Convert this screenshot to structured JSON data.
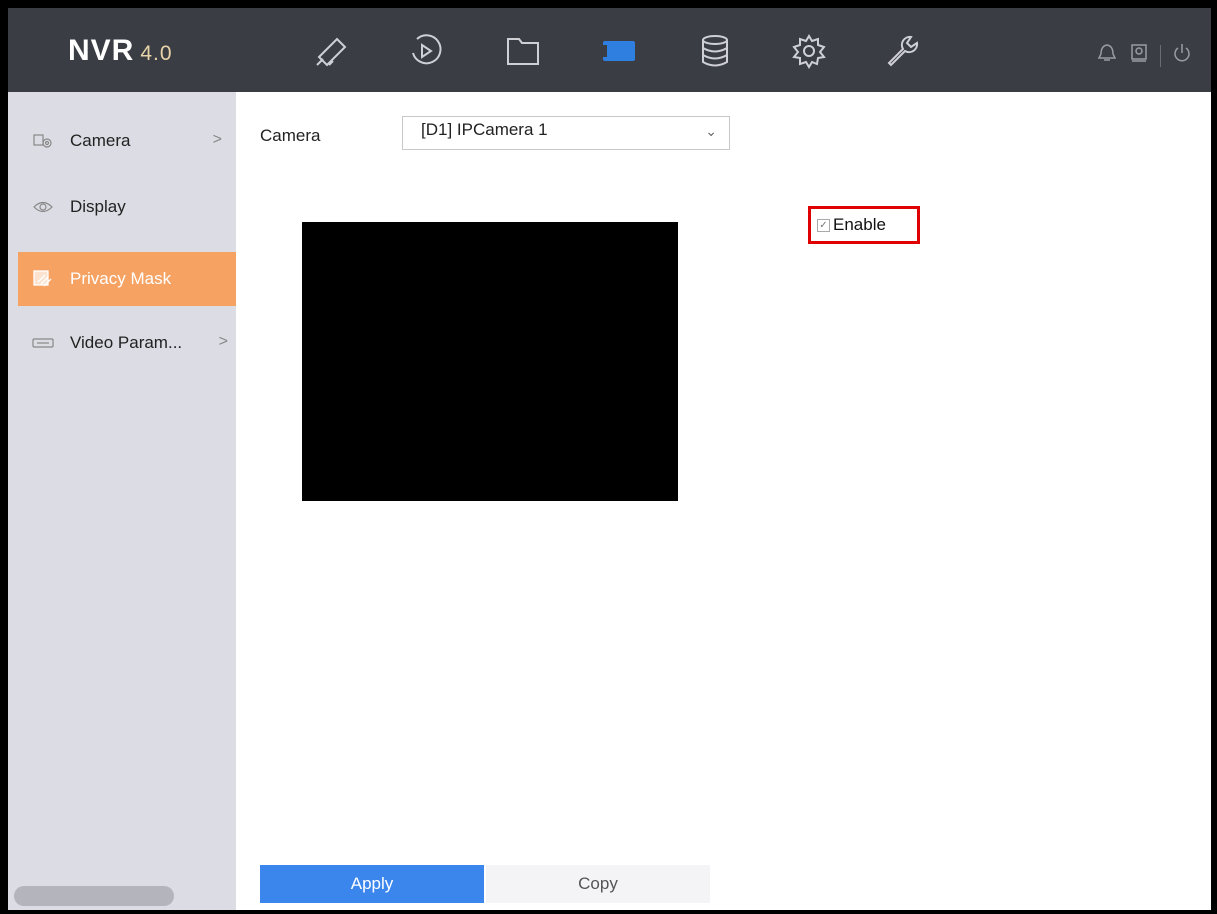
{
  "header": {
    "logo": "NVR",
    "version": "4.0",
    "nav": [
      {
        "name": "live-view",
        "icon": "camera-icon"
      },
      {
        "name": "playback",
        "icon": "playback-icon"
      },
      {
        "name": "file-management",
        "icon": "folder-icon"
      },
      {
        "name": "camera-settings",
        "icon": "video-camera-icon",
        "active": true
      },
      {
        "name": "storage",
        "icon": "database-icon"
      },
      {
        "name": "system",
        "icon": "gear-icon"
      },
      {
        "name": "maintenance",
        "icon": "wrench-icon"
      }
    ],
    "accent": "#2f7fe0"
  },
  "sidebar": {
    "items": [
      {
        "label": "Camera",
        "icon": "camera-settings-icon",
        "has_children": true
      },
      {
        "label": "Display",
        "icon": "eye-icon"
      },
      {
        "label": "Privacy Mask",
        "icon": "privacy-mask-icon",
        "active": true
      },
      {
        "label": "Video Param...",
        "icon": "video-param-icon",
        "has_children": true
      }
    ],
    "active_color": "#f5a263"
  },
  "main": {
    "camera_label": "Camera",
    "camera_value": "[D1] IPCamera 1",
    "enable_label": "Enable",
    "enable_checked": true,
    "apply_label": "Apply",
    "copy_label": "Copy"
  }
}
